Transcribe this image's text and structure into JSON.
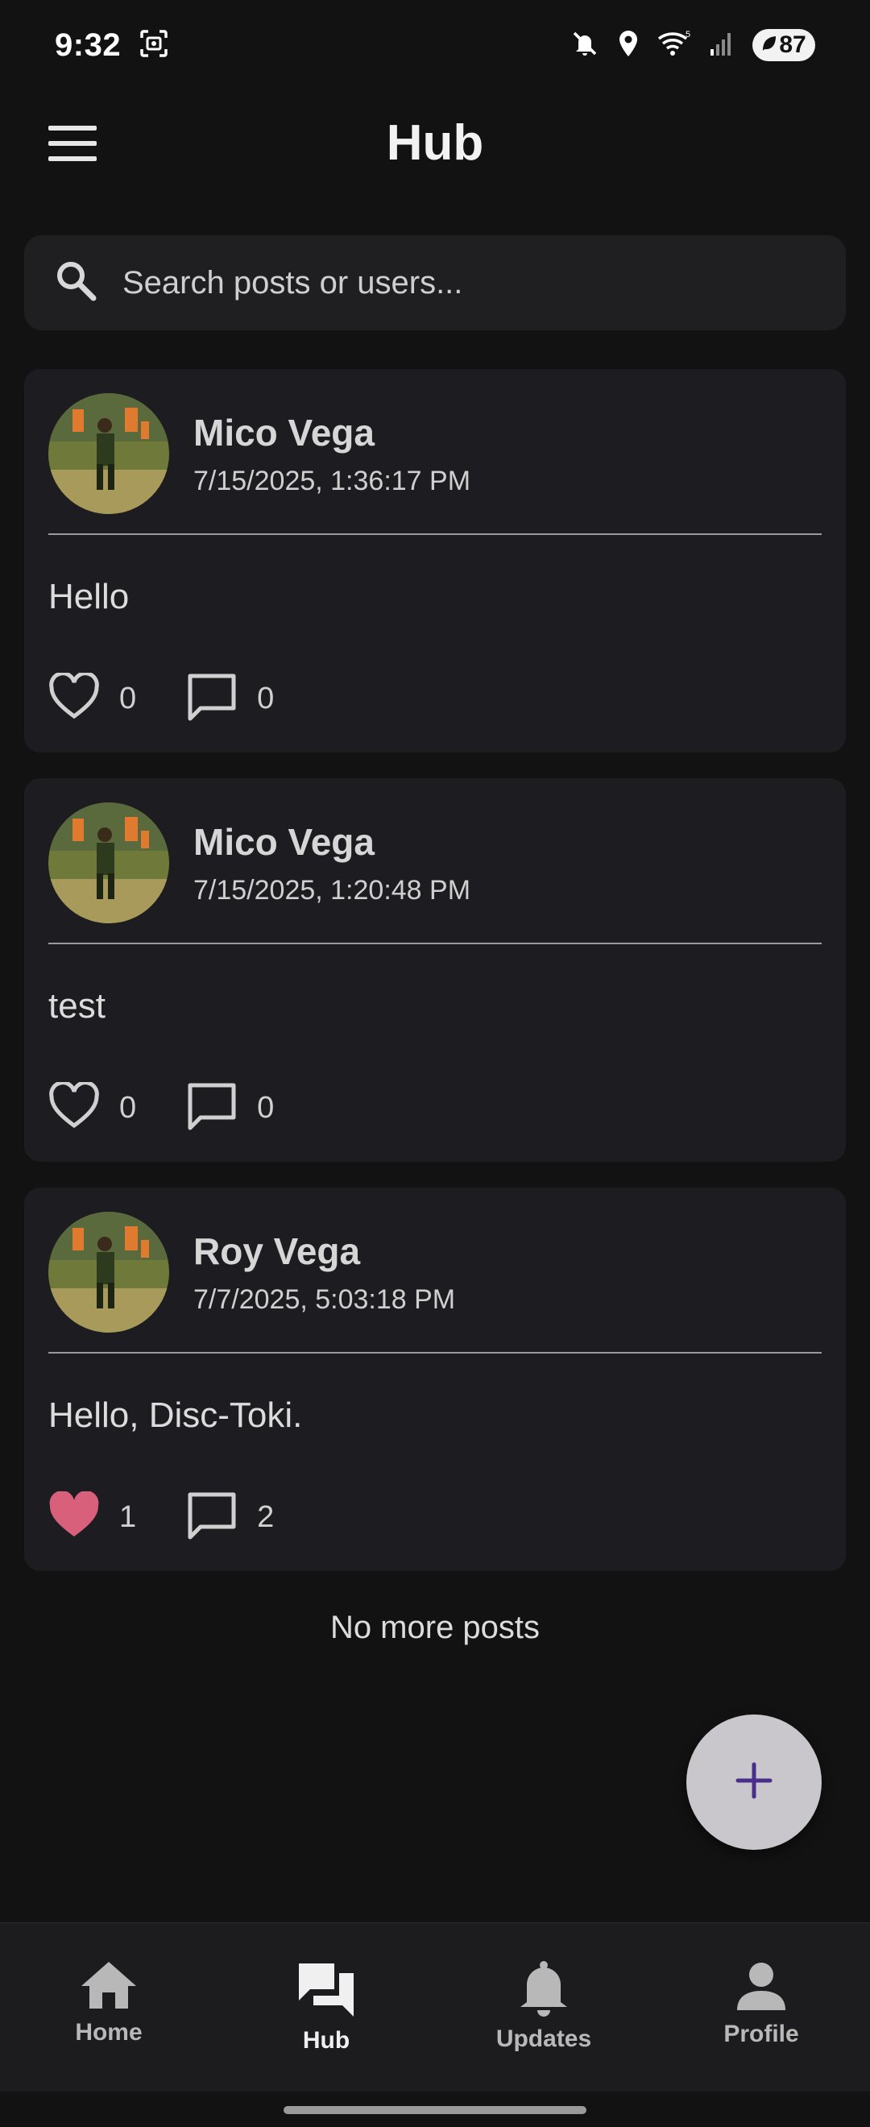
{
  "status": {
    "time": "9:32",
    "battery": "87"
  },
  "header": {
    "title": "Hub"
  },
  "search": {
    "placeholder": "Search posts or users..."
  },
  "posts": [
    {
      "author": "Mico Vega",
      "time": "7/15/2025, 1:36:17 PM",
      "content": "Hello",
      "likes": "0",
      "comments": "0",
      "liked": false
    },
    {
      "author": "Mico Vega",
      "time": "7/15/2025, 1:20:48 PM",
      "content": "test",
      "likes": "0",
      "comments": "0",
      "liked": false
    },
    {
      "author": "Roy Vega",
      "time": "7/7/2025, 5:03:18 PM",
      "content": "Hello, Disc-Toki.",
      "likes": "1",
      "comments": "2",
      "liked": true
    }
  ],
  "feed": {
    "end_text": "No more posts"
  },
  "fab": {
    "icon": "plus-icon",
    "color": "#4a2f8a"
  },
  "nav": {
    "items": [
      {
        "label": "Home",
        "icon": "home-icon"
      },
      {
        "label": "Hub",
        "icon": "forum-icon"
      },
      {
        "label": "Updates",
        "icon": "bell-icon"
      },
      {
        "label": "Profile",
        "icon": "person-icon"
      }
    ],
    "active": "Hub"
  },
  "colors": {
    "background": "#121212",
    "card": "#1d1d21",
    "liked_heart": "#d9607a"
  }
}
